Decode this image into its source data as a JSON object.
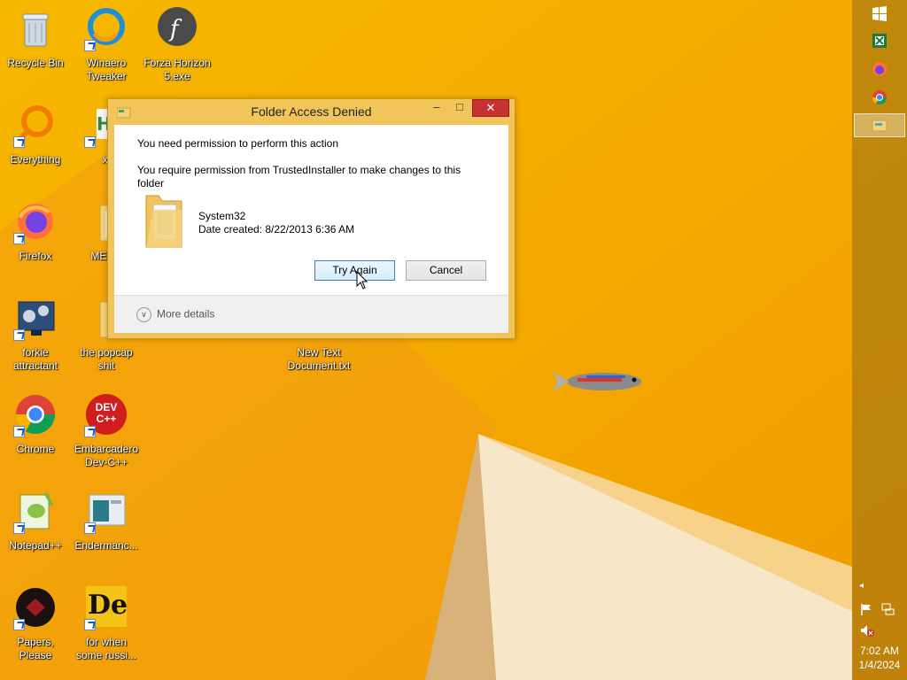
{
  "desktop": {
    "icons": [
      {
        "label": "Recycle Bin"
      },
      {
        "label": "Winaero Tweaker"
      },
      {
        "label": "Forza Horizon 5.exe"
      },
      {
        "label": "Everything"
      },
      {
        "label": "xl"
      },
      {
        "label": "Firefox"
      },
      {
        "label": "MEMZ"
      },
      {
        "label": "forkie attractant"
      },
      {
        "label": "the popcap shit"
      },
      {
        "label": "New Text Document.txt"
      },
      {
        "label": "Chrome"
      },
      {
        "label": "Embarcadero Dev-C++"
      },
      {
        "label": "Notepad++"
      },
      {
        "label": "Endermanc..."
      },
      {
        "label": "Papers, Please"
      },
      {
        "label": "for when some russi..."
      }
    ],
    "devcpp_logo_text": "DEV C++",
    "de_logo_text": "De"
  },
  "dialog": {
    "title": "Folder Access Denied",
    "heading": "You need permission to perform this action",
    "detail": "You require permission from TrustedInstaller to make changes to this folder",
    "item_name": "System32",
    "date_created": "Date created: 8/22/2013 6:36 AM",
    "try_again_label": "Try Again",
    "cancel_label": "Cancel",
    "more_details_label": "More details",
    "minimize": "–",
    "maximize": "□",
    "close": "✕"
  },
  "charms": {
    "icons": [
      "windows-start-icon",
      "excel-icon",
      "firefox-icon",
      "chrome-icon",
      "file-explorer-icon"
    ],
    "tray": {
      "time": "7:02 AM",
      "date": "1/4/2024"
    }
  },
  "colors": {
    "wallpaper_orange": "#f0a800",
    "close_red": "#c7312f",
    "dialog_frame": "#f2c55a"
  }
}
